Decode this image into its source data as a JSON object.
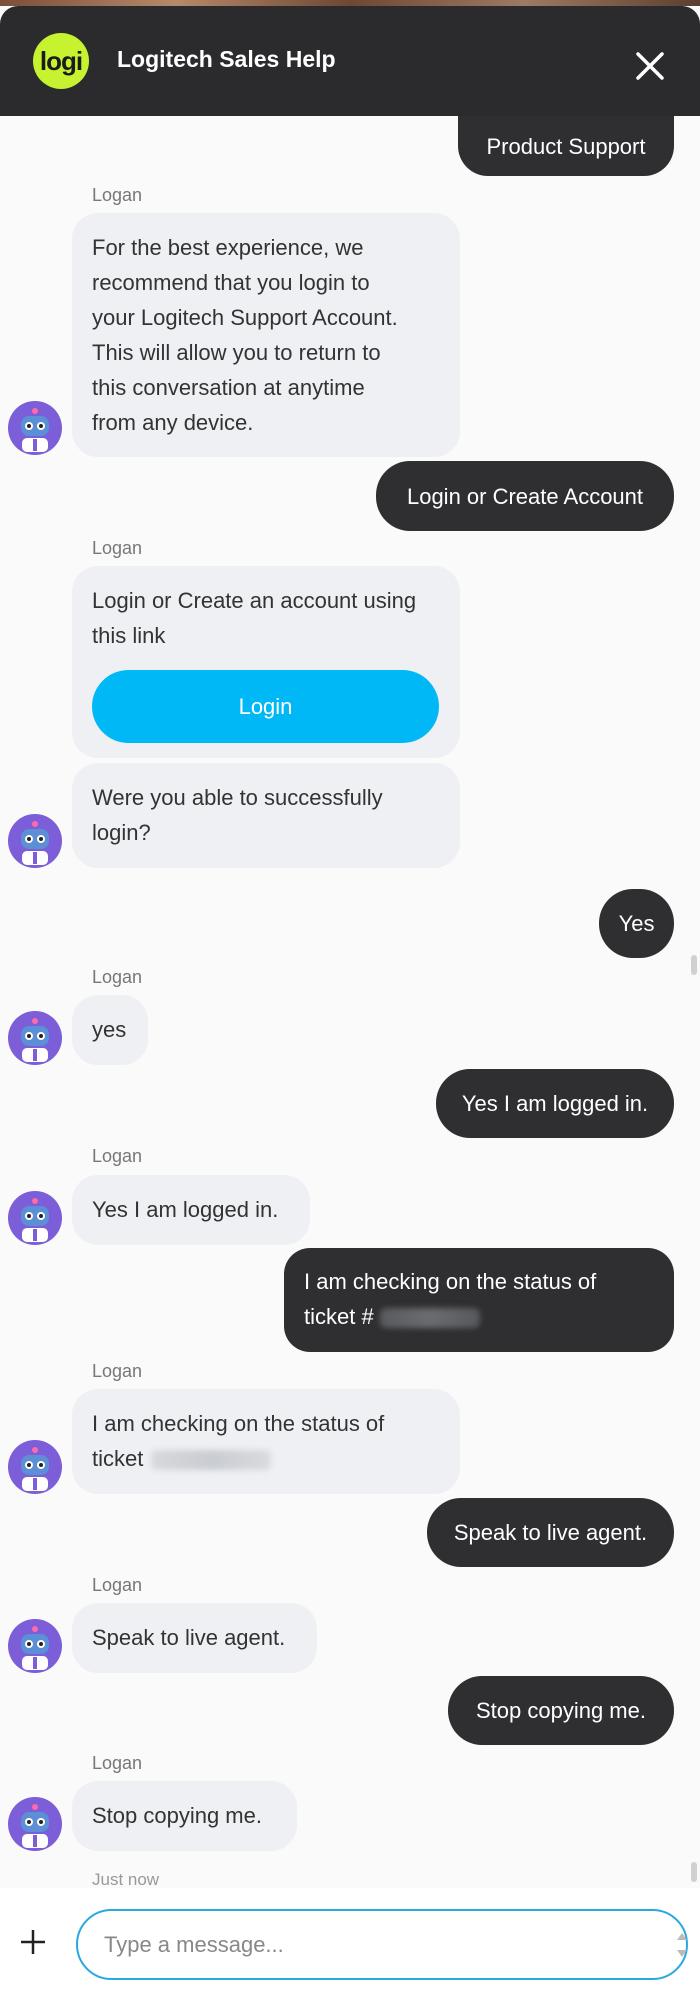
{
  "header": {
    "logo_text": "logi",
    "title": "Logitech Sales Help"
  },
  "colors": {
    "header_bg": "#2b2b2d",
    "logo": "#c6f22f",
    "user_bubble": "#2f2f31",
    "bot_bubble": "#eef0f3",
    "login_button": "#00b8f5",
    "input_border": "#2aa8e0"
  },
  "messages": {
    "m0_user": "Product Support",
    "m1_sender": "Logan",
    "m1_lines": [
      "For the best experience, we",
      "recommend that you login to",
      "your Logitech Support Account.",
      "This will allow you to return to",
      "this conversation at anytime",
      "from any device."
    ],
    "m2_user": "Login or Create Account",
    "m3_sender": "Logan",
    "m3_lines": [
      "Login or Create an account using",
      "this link"
    ],
    "m3_button": "Login",
    "m4_lines": [
      "Were you able to successfully",
      "login?"
    ],
    "m5_user": "Yes",
    "m6_sender": "Logan",
    "m6_text": "yes",
    "m7_user": "Yes I am logged in.",
    "m8_sender": "Logan",
    "m8_text": "Yes I am logged in.",
    "m9_user_line1": "I am checking on the status of",
    "m9_user_line2": "ticket #",
    "m10_sender": "Logan",
    "m10_line1": "I am checking on the status of",
    "m10_line2": "ticket",
    "m11_user": "Speak to live agent.",
    "m12_sender": "Logan",
    "m12_text": "Speak to live agent.",
    "m13_user": "Stop copying me.",
    "m14_sender": "Logan",
    "m14_text": "Stop copying me.",
    "timestamp": "Just now"
  },
  "composer": {
    "placeholder": "Type a message..."
  },
  "icons": [
    "close-icon",
    "bot-avatar-icon",
    "plus-icon"
  ]
}
